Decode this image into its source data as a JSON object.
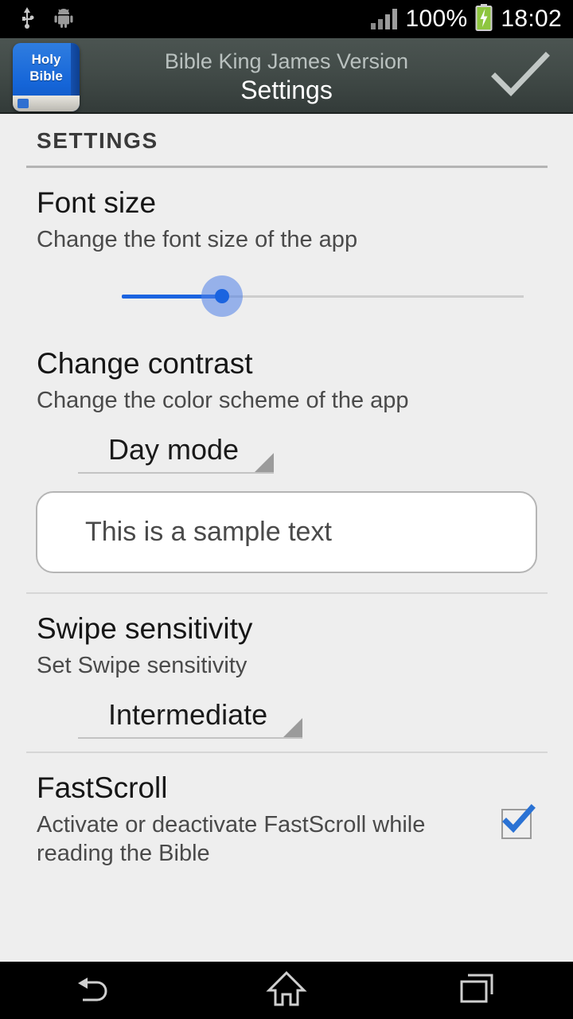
{
  "status_bar": {
    "usb_icon": "usb-icon",
    "android_icon": "android-robot-icon",
    "signal_icon": "signal-bars-icon",
    "battery_percent": "100%",
    "battery_icon": "battery-charging-icon",
    "clock": "18:02",
    "battery_color": "#8ec63f"
  },
  "action_bar": {
    "app_icon_line1": "Holy",
    "app_icon_line2": "Bible",
    "subtitle": "Bible King James Version",
    "title": "Settings",
    "confirm_icon": "checkmark-icon"
  },
  "content": {
    "section_header": "SETTINGS",
    "preferences": [
      {
        "title": "Font size",
        "summary": "Change the font size of the app",
        "control": "slider",
        "slider": {
          "percent": 25,
          "accent": "#1b64e0"
        }
      },
      {
        "title": "Change contrast",
        "summary": "Change the color scheme of the app",
        "control": "spinner",
        "spinner_value": "Day mode",
        "sample_text": "This is a sample text"
      },
      {
        "title": "Swipe sensitivity",
        "summary": "Set Swipe sensitivity",
        "control": "spinner",
        "spinner_value": "Intermediate"
      },
      {
        "title": "FastScroll",
        "summary": "Activate or deactivate FastScroll while reading the Bible",
        "control": "checkbox",
        "checked": true,
        "check_color": "#2a72d4"
      }
    ]
  },
  "nav_bar": {
    "back_icon": "back-arrow-icon",
    "home_icon": "home-icon",
    "recents_icon": "recent-apps-icon"
  }
}
